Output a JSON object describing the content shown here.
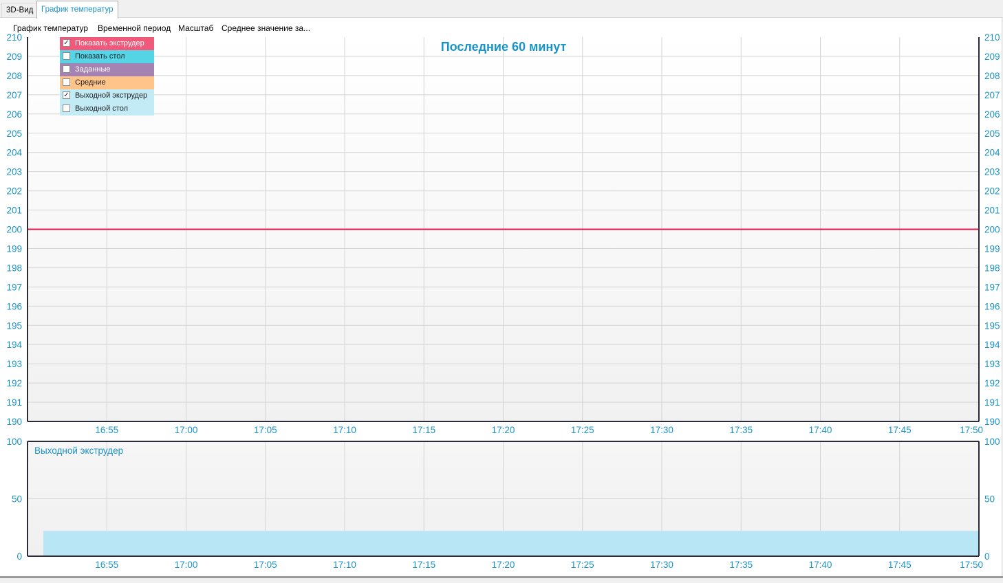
{
  "tabs": [
    {
      "label": "3D-Вид",
      "active": false
    },
    {
      "label": "График температур",
      "active": true
    }
  ],
  "menu": [
    "График температур",
    "Временной период",
    "Масштаб",
    "Среднее значение за..."
  ],
  "legend": [
    {
      "label": "Показать экструдер",
      "checked": true,
      "bg": "#f05a7a",
      "fg": "#ffffff"
    },
    {
      "label": "Показать стол",
      "checked": false,
      "bg": "#55d4e6",
      "fg": "#222222"
    },
    {
      "label": "Заданные",
      "checked": false,
      "bg": "#a483b2",
      "fg": "#ffffff"
    },
    {
      "label": "Средние",
      "checked": false,
      "bg": "#ffc48a",
      "fg": "#222222"
    },
    {
      "label": "Выходной экструдер",
      "checked": true,
      "bg": "#c2ebf6",
      "fg": "#222222"
    },
    {
      "label": "Выходной стол",
      "checked": false,
      "bg": "#c2ebf6",
      "fg": "#222222"
    }
  ],
  "colors": {
    "accent": "#1a93c6",
    "extruder_line": "#e0194d",
    "output_fill": "#b8e6f4",
    "grid": "#d4d4d4",
    "frame": "#2b2b3a"
  },
  "chart_data": [
    {
      "type": "line",
      "title": "Последние 60 минут",
      "x_ticks": [
        "16:55",
        "17:00",
        "17:05",
        "17:10",
        "17:15",
        "17:20",
        "17:25",
        "17:30",
        "17:35",
        "17:40",
        "17:45",
        "17:50"
      ],
      "xlim": [
        "16:50",
        "17:50"
      ],
      "ylim": [
        190,
        210
      ],
      "y_ticks": [
        190,
        191,
        192,
        193,
        194,
        195,
        196,
        197,
        198,
        199,
        200,
        201,
        202,
        203,
        204,
        205,
        206,
        207,
        208,
        209,
        210
      ],
      "y_axis_both_sides": true,
      "grid": true,
      "series": [
        {
          "x": [
            "16:50",
            "17:50"
          ],
          "values": [
            200,
            200
          ],
          "color": "#e0194d"
        }
      ]
    },
    {
      "type": "area",
      "label": "Выходной экструдер",
      "x_ticks": [
        "16:55",
        "17:00",
        "17:05",
        "17:10",
        "17:15",
        "17:20",
        "17:25",
        "17:30",
        "17:35",
        "17:40",
        "17:45",
        "17:50"
      ],
      "xlim": [
        "16:50",
        "17:50"
      ],
      "ylim": [
        0,
        100
      ],
      "y_ticks": [
        0,
        50,
        100
      ],
      "y_axis_both_sides": true,
      "grid": true,
      "series": [
        {
          "x": [
            "16:51",
            "17:50"
          ],
          "values": [
            22,
            22
          ],
          "color": "#b8e6f4"
        }
      ]
    }
  ]
}
